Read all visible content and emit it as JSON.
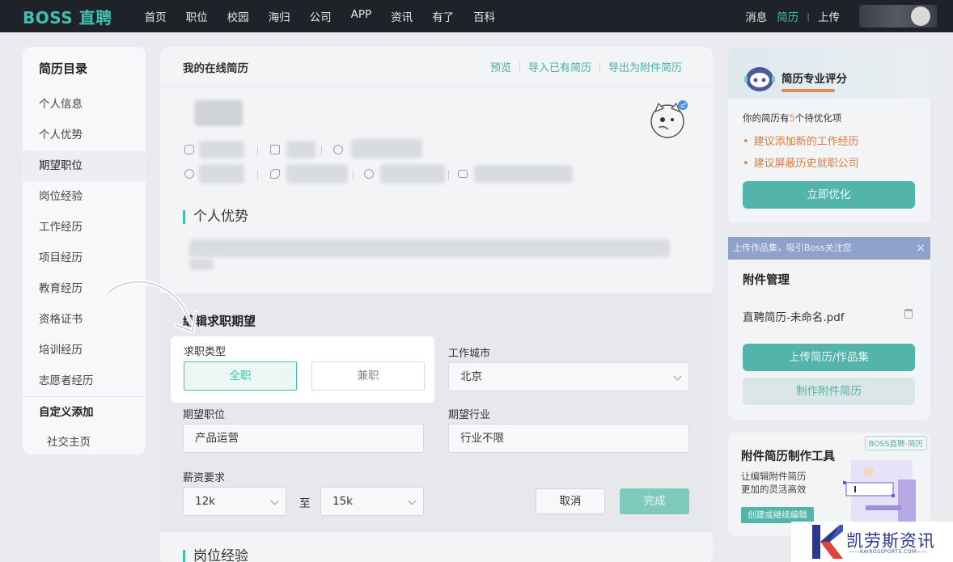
{
  "nav": {
    "logo": "BOSS 直聘",
    "items": [
      "首页",
      "职位",
      "校园",
      "海归",
      "公司",
      "APP",
      "资讯",
      "有了",
      "百科"
    ],
    "right": {
      "messages": "消息",
      "resume": "简历",
      "upload": "上传"
    }
  },
  "sidebar": {
    "title": "简历目录",
    "items": [
      "个人信息",
      "个人优势",
      "期望职位",
      "岗位经验",
      "工作经历",
      "项目经历",
      "教育经历",
      "资格证书",
      "培训经历",
      "志愿者经历"
    ],
    "custom_group": "自定义添加",
    "custom_items": [
      "社交主页"
    ]
  },
  "main": {
    "title": "我的在线简历",
    "actions": [
      "预览",
      "导入已有简历",
      "导出为附件简历"
    ],
    "section_advantage": "个人优势",
    "edit_title": "编辑求职期望",
    "job_type_label": "求职类型",
    "job_type_options": [
      "全职",
      "兼职"
    ],
    "city_label": "工作城市",
    "city_value": "北京",
    "position_label": "期望职位",
    "position_value": "产品运营",
    "industry_label": "期望行业",
    "industry_value": "行业不限",
    "salary_label": "薪资要求",
    "salary_min": "12k",
    "salary_to": "至",
    "salary_max": "15k",
    "cancel": "取消",
    "done": "完成",
    "section_experience": "岗位经验"
  },
  "score": {
    "title": "简历专业评分",
    "desc_prefix": "你的简历有",
    "desc_count": "5",
    "desc_suffix": "个待优化项",
    "items": [
      "建议添加新的工作经历",
      "建议屏蔽历史就职公司"
    ],
    "button": "立即优化",
    "progress": 0.72
  },
  "banner": {
    "text": "上传作品集，吸引Boss关注您",
    "close": "×"
  },
  "attach": {
    "title": "附件管理",
    "file": "直聘简历-未命名.pdf",
    "upload_btn": "上传简历/作品集",
    "make_btn": "制作附件简历"
  },
  "tool": {
    "badge": "BOSS直聘-简历",
    "title": "附件简历制作工具",
    "desc1": "让编辑附件简历",
    "desc2": "更加的灵活高效",
    "button": "创建或继续编辑"
  },
  "watermark": {
    "text": "凯劳斯资讯",
    "sub": "——KAIROSSPORTS.COM——"
  },
  "colors": {
    "accent": "#3fbfb0",
    "nav_bg": "#1f2329",
    "warning": "#e07b3a"
  }
}
